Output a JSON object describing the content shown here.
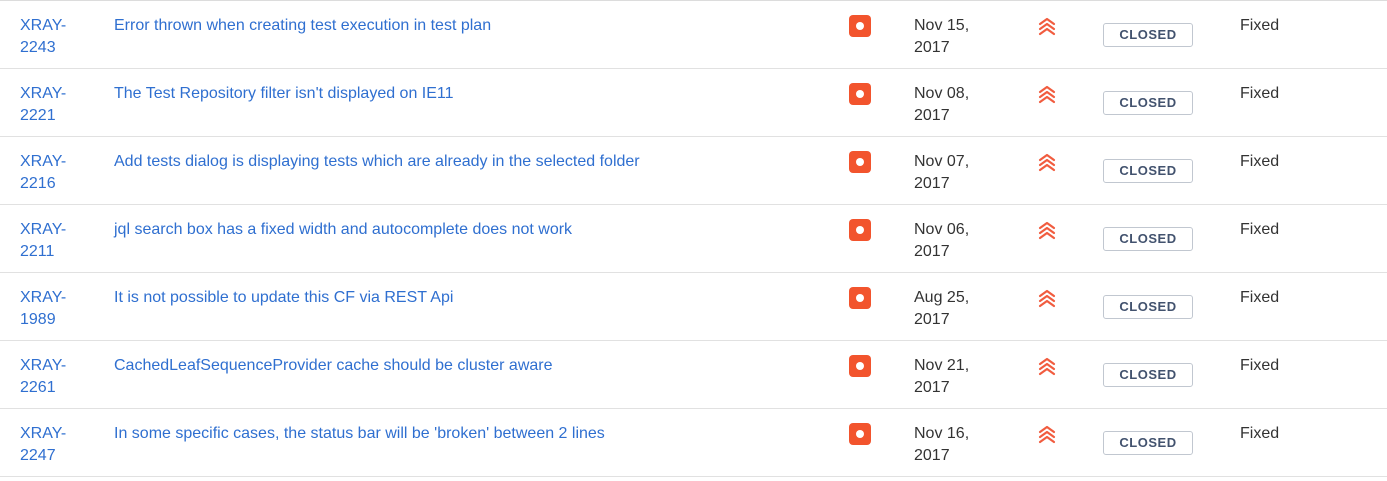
{
  "issues": [
    {
      "key": "XRAY-2243",
      "key_line1": "XRAY-",
      "key_line2": "2243",
      "summary": "Error thrown when creating test execution in test plan",
      "date_line1": "Nov 15,",
      "date_line2": "2017",
      "status": "CLOSED",
      "resolution": "Fixed"
    },
    {
      "key": "XRAY-2221",
      "key_line1": "XRAY-",
      "key_line2": "2221",
      "summary": "The Test Repository filter isn't displayed on IE11",
      "date_line1": "Nov 08,",
      "date_line2": "2017",
      "status": "CLOSED",
      "resolution": "Fixed"
    },
    {
      "key": "XRAY-2216",
      "key_line1": "XRAY-",
      "key_line2": "2216",
      "summary": "Add tests dialog is displaying tests which are already in the selected folder",
      "date_line1": "Nov 07,",
      "date_line2": "2017",
      "status": "CLOSED",
      "resolution": "Fixed"
    },
    {
      "key": "XRAY-2211",
      "key_line1": "XRAY-",
      "key_line2": "2211",
      "summary": "jql search box has a fixed width and autocomplete does not work",
      "date_line1": "Nov 06,",
      "date_line2": "2017",
      "status": "CLOSED",
      "resolution": "Fixed"
    },
    {
      "key": "XRAY-1989",
      "key_line1": "XRAY-",
      "key_line2": "1989",
      "summary": "It is not possible to update this CF via REST Api",
      "date_line1": "Aug 25,",
      "date_line2": "2017",
      "status": "CLOSED",
      "resolution": "Fixed"
    },
    {
      "key": "XRAY-2261",
      "key_line1": "XRAY-",
      "key_line2": "2261",
      "summary": "CachedLeafSequenceProvider cache should be cluster aware",
      "date_line1": "Nov 21,",
      "date_line2": "2017",
      "status": "CLOSED",
      "resolution": "Fixed"
    },
    {
      "key": "XRAY-2247",
      "key_line1": "XRAY-",
      "key_line2": "2247",
      "summary": "In some specific cases, the status bar will be 'broken' between 2 lines",
      "date_line1": "Nov 16,",
      "date_line2": "2017",
      "status": "CLOSED",
      "resolution": "Fixed"
    }
  ],
  "icons": {
    "issue_type": "bug-icon",
    "priority": "highest-priority-icon"
  },
  "colors": {
    "link": "#2f6fd0",
    "bug": "#f2542d",
    "priority": "#f15c3f",
    "status_border": "#c1c7d0",
    "status_text": "#42526e"
  }
}
